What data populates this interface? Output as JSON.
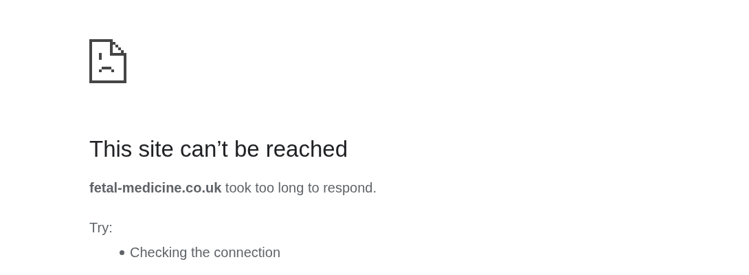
{
  "heading": "This site can’t be reached",
  "message": "**fetal-medicine.co.uk** took too long to respond.",
  "try_label": "Try:",
  "suggestions": [
    "Checking the connection"
  ]
}
